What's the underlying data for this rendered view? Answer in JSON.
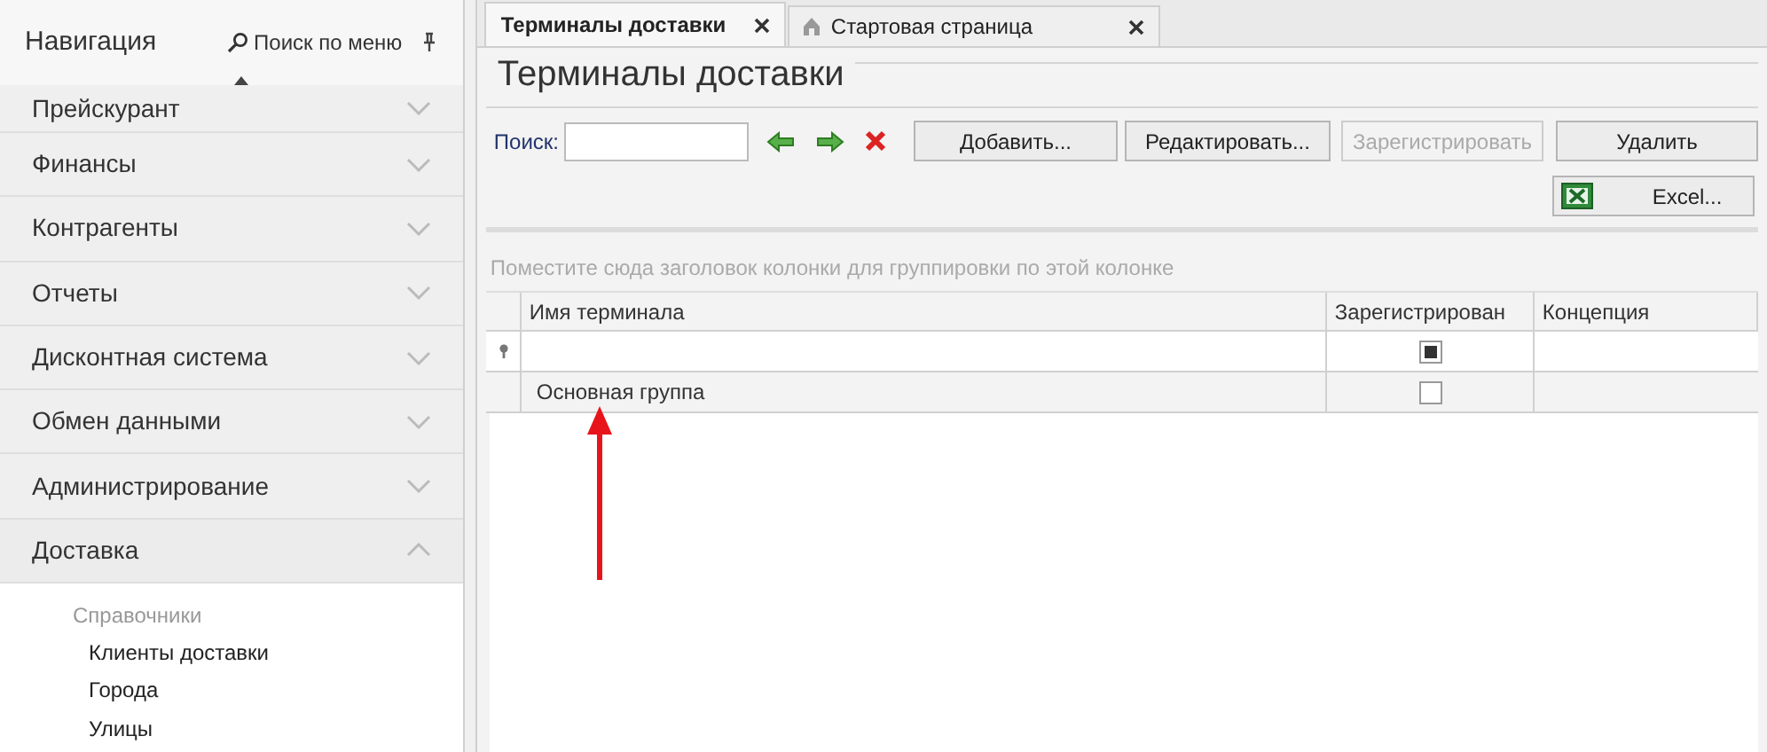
{
  "navigation": {
    "title": "Навигация",
    "search_label": "Поиск по меню",
    "pinned": true,
    "items": [
      {
        "label": "Прейскурант",
        "expanded": false
      },
      {
        "label": "Финансы",
        "expanded": false
      },
      {
        "label": "Контрагенты",
        "expanded": false
      },
      {
        "label": "Отчеты",
        "expanded": false
      },
      {
        "label": "Дисконтная система",
        "expanded": false
      },
      {
        "label": "Обмен данными",
        "expanded": false
      },
      {
        "label": "Администрирование",
        "expanded": false
      },
      {
        "label": "Доставка",
        "expanded": true,
        "children": [
          {
            "kind": "section",
            "label": "Справочники"
          },
          {
            "kind": "link",
            "label": "Клиенты доставки"
          },
          {
            "kind": "link",
            "label": "Города"
          },
          {
            "kind": "link",
            "label": "Улицы"
          }
        ]
      }
    ]
  },
  "tabs": [
    {
      "label": "Терминалы доставки",
      "selected": true,
      "home": false
    },
    {
      "label": "Стартовая страница",
      "selected": false,
      "home": true
    }
  ],
  "page_title": "Терминалы доставки",
  "toolbar": {
    "search_label": "Поиск:",
    "buttons": [
      {
        "label": "Добавить...",
        "disabled": false
      },
      {
        "label": "Редактировать...",
        "disabled": false
      },
      {
        "label": "Зарегистрировать",
        "disabled": true
      },
      {
        "label": "Удалить",
        "disabled": false
      }
    ],
    "export_button": "Excel..."
  },
  "grid": {
    "group_panel_hint": "Поместите сюда заголовок колонки для группировки по этой колонке",
    "columns": [
      "Имя терминала",
      "Зарегистрирован",
      "Концепция"
    ],
    "filter_row": {
      "registered_indeterminate": true
    },
    "rows": [
      {
        "name": "Основная группа",
        "registered": false
      }
    ]
  }
}
